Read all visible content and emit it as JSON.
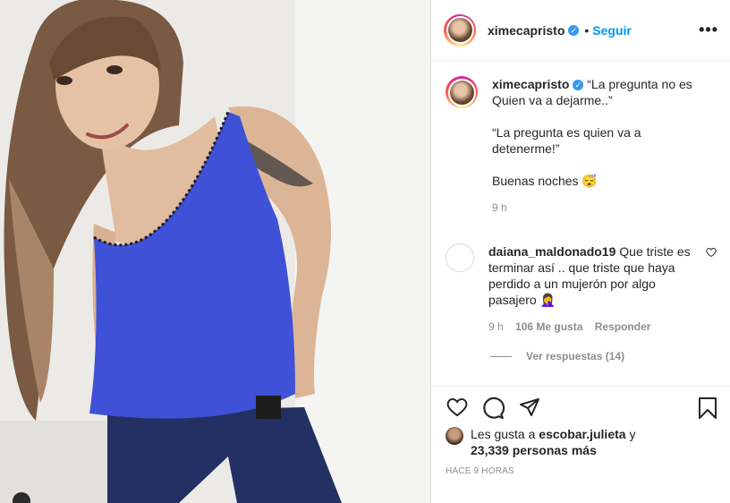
{
  "post": {
    "username": "ximecapristo",
    "verified": true,
    "follow_label": "Seguir",
    "separator": "•",
    "more": "•••"
  },
  "caption": {
    "username": "ximecapristo",
    "paragraphs": [
      "“La pregunta no es Quien va a dejarme..”",
      "“La pregunta es quien va a detenerme!”",
      "Buenas noches 😴"
    ],
    "time": "9 h"
  },
  "comment": {
    "username": "daiana_maldonado19",
    "text": "Que triste es terminar así .. que triste que haya perdido a un mujerón por algo pasajero 🤦‍♀️",
    "time": "9 h",
    "likes": "106 Me gusta",
    "reply": "Responder",
    "view_replies": "Ver respuestas (14)"
  },
  "likes": {
    "prefix": "Les gusta a ",
    "user": "escobar.julieta",
    "suffix": " y",
    "count": "23,339 personas más"
  },
  "timestamp": "HACE 9 HORAS",
  "colors": {
    "link": "#0095f6",
    "verified": "#3897f0",
    "top_blue": "#3f51d6"
  }
}
